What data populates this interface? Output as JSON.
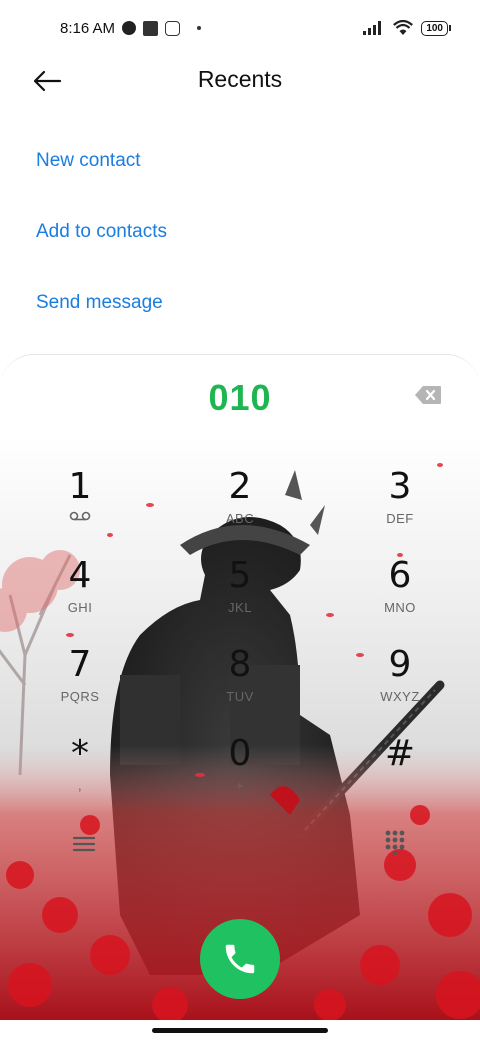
{
  "status_bar": {
    "time": "8:16 AM",
    "battery": "100",
    "icons": [
      "alarm-icon",
      "notification-square-icon",
      "mi-icon",
      "dot-icon",
      "signal-icon",
      "wifi-icon",
      "battery-icon"
    ]
  },
  "header": {
    "title": "Recents",
    "back_icon": "arrow-left-icon"
  },
  "actions": [
    {
      "label": "New contact"
    },
    {
      "label": "Add to contacts"
    },
    {
      "label": "Send message"
    }
  ],
  "dialer": {
    "number": "010",
    "number_color": "#1fb550",
    "keys": [
      {
        "digit": "1",
        "letters": ""
      },
      {
        "digit": "2",
        "letters": "ABC"
      },
      {
        "digit": "3",
        "letters": "DEF"
      },
      {
        "digit": "4",
        "letters": "GHI"
      },
      {
        "digit": "5",
        "letters": "JKL"
      },
      {
        "digit": "6",
        "letters": "MNO"
      },
      {
        "digit": "7",
        "letters": "PQRS"
      },
      {
        "digit": "8",
        "letters": "TUV"
      },
      {
        "digit": "9",
        "letters": "WXYZ"
      },
      {
        "digit": "*",
        "letters": ","
      },
      {
        "digit": "0",
        "letters": "+"
      },
      {
        "digit": "#",
        "letters": ""
      }
    ],
    "call_color": "#20c160",
    "accent_link_color": "#1a7de0"
  }
}
